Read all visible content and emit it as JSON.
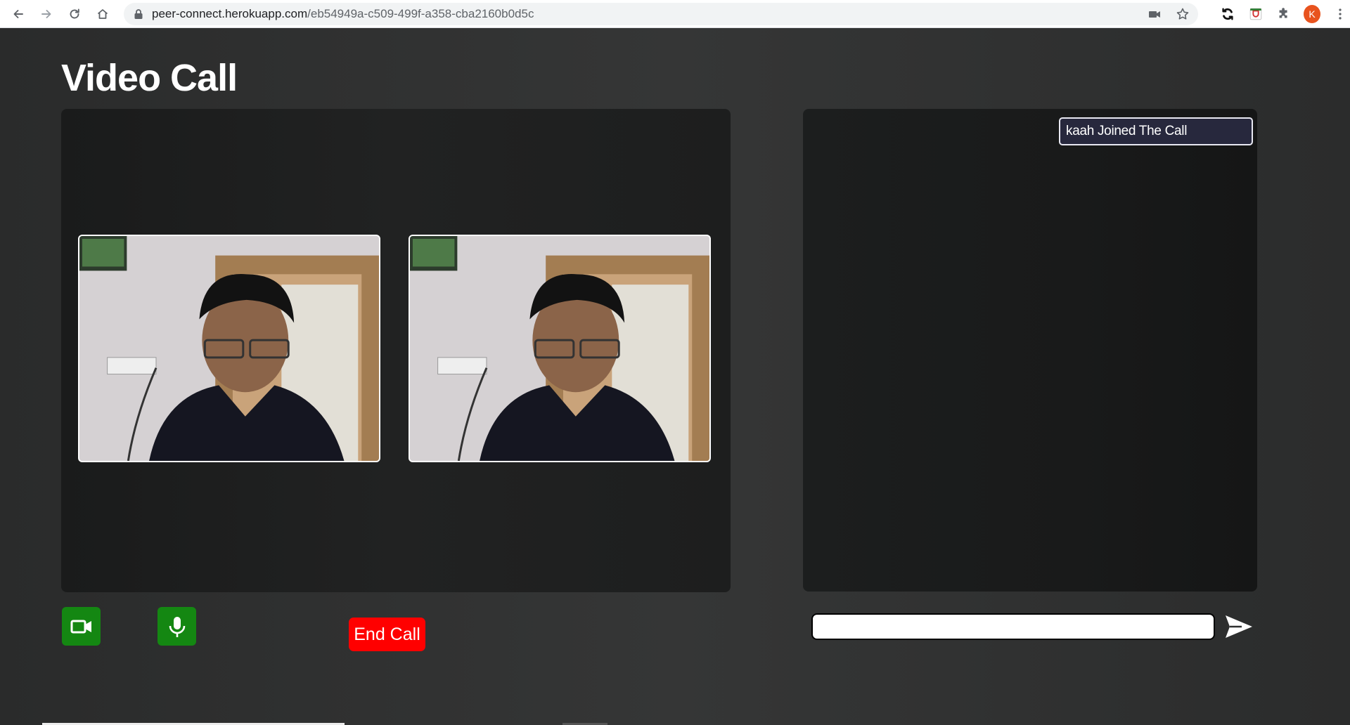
{
  "browser": {
    "url_host": "peer-connect.herokuapp.com",
    "url_path": "/eb54949a-c509-499f-a358-cba2160b0d5c",
    "profile_initial": "K"
  },
  "page": {
    "title": "Video Call"
  },
  "videos": [
    {
      "label": "local-video"
    },
    {
      "label": "remote-video"
    }
  ],
  "chat": {
    "messages": [
      "kaah Joined The Call"
    ],
    "input_value": "",
    "input_placeholder": ""
  },
  "controls": {
    "end_call_label": "End Call"
  },
  "colors": {
    "control_green": "#148712",
    "end_call_red": "#ff0000",
    "message_bg": "#27283d"
  }
}
